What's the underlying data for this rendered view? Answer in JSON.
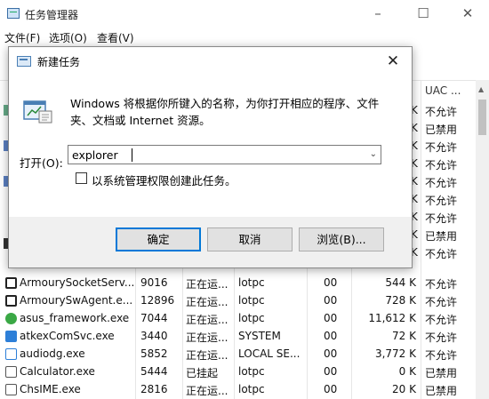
{
  "task_manager": {
    "title": "任务管理器",
    "menu": [
      "文件(F)",
      "选项(O)",
      "查看(V)"
    ],
    "uac_header": "UAC ...",
    "side_rows": [
      {
        "k": "K",
        "uac": "不允许"
      },
      {
        "k": "K",
        "uac": "已禁用"
      },
      {
        "k": "K",
        "uac": "不允许"
      },
      {
        "k": "K",
        "uac": "不允许"
      },
      {
        "k": "K",
        "uac": "不允许"
      },
      {
        "k": "K",
        "uac": "不允许"
      },
      {
        "k": "K",
        "uac": "不允许"
      },
      {
        "k": "K",
        "uac": "已禁用"
      },
      {
        "k": "K",
        "uac": "不允许"
      }
    ],
    "rows": [
      {
        "name": "ArmourySocketServ...",
        "pid": "9016",
        "status": "正在运...",
        "user": "lotpc",
        "cpu": "00",
        "mem": "544 K",
        "uac": "不允许"
      },
      {
        "name": "ArmourySwAgent.e...",
        "pid": "12896",
        "status": "正在运...",
        "user": "lotpc",
        "cpu": "00",
        "mem": "728 K",
        "uac": "不允许"
      },
      {
        "name": "asus_framework.exe",
        "pid": "7044",
        "status": "正在运...",
        "user": "lotpc",
        "cpu": "00",
        "mem": "11,612 K",
        "uac": "不允许"
      },
      {
        "name": "atkexComSvc.exe",
        "pid": "3440",
        "status": "正在运...",
        "user": "SYSTEM",
        "cpu": "00",
        "mem": "72 K",
        "uac": "不允许"
      },
      {
        "name": "audiodg.exe",
        "pid": "5852",
        "status": "正在运...",
        "user": "LOCAL SE...",
        "cpu": "00",
        "mem": "3,772 K",
        "uac": "不允许"
      },
      {
        "name": "Calculator.exe",
        "pid": "5444",
        "status": "已挂起",
        "user": "lotpc",
        "cpu": "00",
        "mem": "0 K",
        "uac": "已禁用"
      },
      {
        "name": "ChsIME.exe",
        "pid": "2816",
        "status": "正在运...",
        "user": "lotpc",
        "cpu": "00",
        "mem": "20 K",
        "uac": "已禁用"
      }
    ]
  },
  "run_dialog": {
    "title": "新建任务",
    "description": "Windows 将根据你所键入的名称，为你打开相应的程序、文件夹、文档或 Internet 资源。",
    "open_label": "打开(O):",
    "open_value": "explorer",
    "admin_checkbox_label": "以系统管理权限创建此任务。",
    "admin_checked": false,
    "ok_label": "确定",
    "cancel_label": "取消",
    "browse_label": "浏览(B)..."
  },
  "colors": {
    "accent": "#0078d7",
    "dialog_bg": "#f0f0f0",
    "button_bg": "#e1e1e1"
  }
}
